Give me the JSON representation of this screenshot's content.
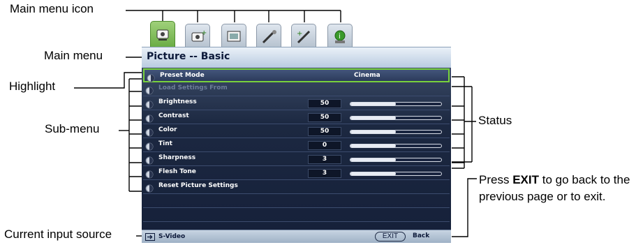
{
  "callouts": {
    "main_menu_icon": "Main menu icon",
    "main_menu": "Main menu",
    "highlight": "Highlight",
    "sub_menu": "Sub-menu",
    "status": "Status",
    "current_input_source": "Current input source",
    "exit_note_prefix": "Press",
    "exit_note_key": "EXIT",
    "exit_note_suffix": "to go back to the previous page or to exit."
  },
  "osd": {
    "tabs": [
      {
        "icon": "picture-icon",
        "active": true
      },
      {
        "icon": "picture-advanced-icon",
        "active": false
      },
      {
        "icon": "display-icon",
        "active": false
      },
      {
        "icon": "system-setup-basic-icon",
        "active": false
      },
      {
        "icon": "system-setup-advanced-icon",
        "active": false
      },
      {
        "icon": "information-icon",
        "active": false
      }
    ],
    "title": "Picture -- Basic",
    "rows": [
      {
        "name": "preset-mode",
        "icon": "preset-mode-icon",
        "label": "Preset Mode",
        "value": "Cinema",
        "kind": "text",
        "highlight": true
      },
      {
        "name": "load-settings-from",
        "icon": "load-settings-icon",
        "label": "Load Settings From",
        "kind": "none",
        "disabled": true
      },
      {
        "name": "brightness",
        "icon": "brightness-icon",
        "label": "Brightness",
        "value": "50",
        "level": 0.5,
        "kind": "slider"
      },
      {
        "name": "contrast",
        "icon": "contrast-icon",
        "label": "Contrast",
        "value": "50",
        "level": 0.5,
        "kind": "slider"
      },
      {
        "name": "color",
        "icon": "color-icon",
        "label": "Color",
        "value": "50",
        "level": 0.5,
        "kind": "slider"
      },
      {
        "name": "tint",
        "icon": "tint-icon",
        "label": "Tint",
        "value": "0",
        "level": 0.5,
        "kind": "slider"
      },
      {
        "name": "sharpness",
        "icon": "sharpness-icon",
        "label": "Sharpness",
        "value": "3",
        "level": 0.5,
        "kind": "slider"
      },
      {
        "name": "flesh-tone",
        "icon": "flesh-tone-icon",
        "label": "Flesh Tone",
        "value": "3",
        "level": 0.5,
        "kind": "slider"
      },
      {
        "name": "reset-picture-settings",
        "icon": "reset-icon",
        "label": "Reset Picture Settings",
        "kind": "none"
      },
      {
        "name": "empty-row-1",
        "kind": "empty"
      },
      {
        "name": "empty-row-2",
        "kind": "empty"
      }
    ],
    "footer": {
      "source": "S-Video",
      "source_icon": "input-source-icon",
      "exit_key": "EXIT",
      "back": "Back"
    }
  },
  "colors": {
    "highlight_border": "#78d23c",
    "active_tab": "#6bad45",
    "menu_body": "#1c2841"
  }
}
